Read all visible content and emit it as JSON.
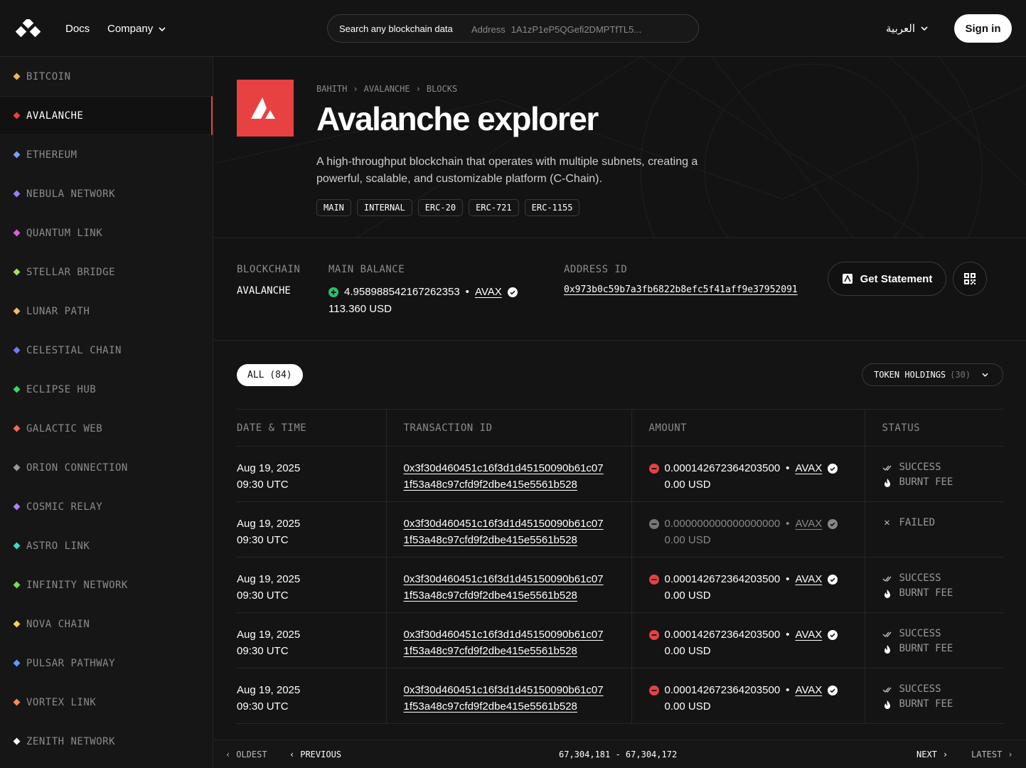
{
  "header": {
    "nav_docs": "Docs",
    "nav_company": "Company",
    "search_label": "Search any blockchain data",
    "search_hint_key": "Address",
    "search_hint_value": "1A1zP1eP5QGefi2DMPTfTL5...",
    "language": "العربية",
    "signin": "Sign in"
  },
  "sidebar": {
    "items": [
      {
        "label": "BITCOIN",
        "color": "#f7b24a"
      },
      {
        "label": "AVALANCHE",
        "color": "#e84142",
        "active": true
      },
      {
        "label": "ETHEREUM",
        "color": "#7b9cff"
      },
      {
        "label": "NEBULA NETWORK",
        "color": "#9c7bff"
      },
      {
        "label": "QUANTUM LINK",
        "color": "#e05ad8"
      },
      {
        "label": "STELLAR BRIDGE",
        "color": "#a6e05a"
      },
      {
        "label": "LUNAR PATH",
        "color": "#f0c05a"
      },
      {
        "label": "CELESTIAL CHAIN",
        "color": "#6f7bff"
      },
      {
        "label": "ECLIPSE HUB",
        "color": "#3ad96a"
      },
      {
        "label": "GALACTIC WEB",
        "color": "#ff6a4a"
      },
      {
        "label": "ORION CONNECTION",
        "color": "#9a9a9a"
      },
      {
        "label": "COSMIC RELAY",
        "color": "#b47bff"
      },
      {
        "label": "ASTRO LINK",
        "color": "#3ad9c8"
      },
      {
        "label": "INFINITY NETWORK",
        "color": "#7bd94a"
      },
      {
        "label": "NOVA CHAIN",
        "color": "#f7d24a"
      },
      {
        "label": "PULSAR PATHWAY",
        "color": "#5a9cff"
      },
      {
        "label": "VORTEX LINK",
        "color": "#ff8a4a"
      },
      {
        "label": "ZENITH NETWORK",
        "color": "#ffffff"
      }
    ]
  },
  "hero": {
    "breadcrumb": [
      "BAHITH",
      "AVALANCHE",
      "BLOCKS"
    ],
    "title": "Avalanche explorer",
    "description": "A high-throughput blockchain that operates with multiple subnets, creating a powerful, scalable, and customizable platform (C-Chain).",
    "tags": [
      "MAIN",
      "INTERNAL",
      "ERC-20",
      "ERC-721",
      "ERC-1155"
    ],
    "brand_color": "#e84142"
  },
  "info": {
    "blockchain_label": "BLOCKCHAIN",
    "blockchain_value": "AVALANCHE",
    "balance_label": "MAIN BALANCE",
    "balance_amount": "4.958988542167262353",
    "balance_token": "AVAX",
    "balance_usd": "113.360 USD",
    "address_label": "ADDRESS ID",
    "address_value": "0x973b0c59b7a3fb6822b8efc5f41aff9e37952091",
    "statement_button": "Get Statement"
  },
  "transactions": {
    "filter_all": "ALL (84)",
    "holdings_label": "TOKEN HOLDINGS",
    "holdings_count": "(30)",
    "columns": [
      "DATE & TIME",
      "TRANSACTION ID",
      "AMOUNT",
      "STATUS"
    ],
    "rows": [
      {
        "date": "Aug 19, 2025",
        "time": "09:30 UTC",
        "tx1": "0x3f30d460451c16f3d1d45150090b61c07",
        "tx2": "1f53a48c97cfd9f2dbe415e5561b528",
        "amount": "0.000142672364203500",
        "token": "AVAX",
        "usd": "0.00 USD",
        "status": "SUCCESS",
        "status2": "BURNT FEE",
        "failed": false
      },
      {
        "date": "Aug 19, 2025",
        "time": "09:30 UTC",
        "tx1": "0x3f30d460451c16f3d1d45150090b61c07",
        "tx2": "1f53a48c97cfd9f2dbe415e5561b528",
        "amount": "0.000000000000000000",
        "token": "AVAX",
        "usd": "0.00 USD",
        "status": "FAILED",
        "status2": "",
        "failed": true
      },
      {
        "date": "Aug 19, 2025",
        "time": "09:30 UTC",
        "tx1": "0x3f30d460451c16f3d1d45150090b61c07",
        "tx2": "1f53a48c97cfd9f2dbe415e5561b528",
        "amount": "0.000142672364203500",
        "token": "AVAX",
        "usd": "0.00 USD",
        "status": "SUCCESS",
        "status2": "BURNT FEE",
        "failed": false
      },
      {
        "date": "Aug 19, 2025",
        "time": "09:30 UTC",
        "tx1": "0x3f30d460451c16f3d1d45150090b61c07",
        "tx2": "1f53a48c97cfd9f2dbe415e5561b528",
        "amount": "0.000142672364203500",
        "token": "AVAX",
        "usd": "0.00 USD",
        "status": "SUCCESS",
        "status2": "BURNT FEE",
        "failed": false
      },
      {
        "date": "Aug 19, 2025",
        "time": "09:30 UTC",
        "tx1": "0x3f30d460451c16f3d1d45150090b61c07",
        "tx2": "1f53a48c97cfd9f2dbe415e5561b528",
        "amount": "0.000142672364203500",
        "token": "AVAX",
        "usd": "0.00 USD",
        "status": "SUCCESS",
        "status2": "BURNT FEE",
        "failed": false
      }
    ]
  },
  "pager": {
    "oldest": "OLDEST",
    "previous": "PREVIOUS",
    "range": "67,304,181 - 67,304,172",
    "next": "NEXT",
    "latest": "LATEST"
  }
}
